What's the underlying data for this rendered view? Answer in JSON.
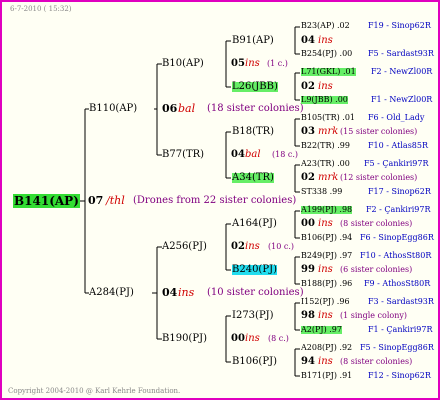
{
  "header": "6-7-2010 ( 15:32)",
  "footer": "Copyright 2004-2010 @ Karl Kehrle Foundation.",
  "root": {
    "label": "B141(AP)",
    "gen": "07",
    "mating": "/thl",
    "note": "(Drones from 22 sister colonies)"
  },
  "level1": [
    {
      "label": "B110(AP)",
      "gen": "06",
      "mating": "bal",
      "note": "(18 sister colonies)"
    },
    {
      "label": "A284(PJ)",
      "gen": "04",
      "mating": "ins",
      "note": "(10 sister colonies)"
    }
  ],
  "level2": [
    {
      "label": "B10(AP)",
      "gen": "05",
      "mating": "ins",
      "note": "(1 c.)"
    },
    {
      "label": "B77(TR)",
      "gen": "04",
      "mating": "bal",
      "note": "(18 c.)"
    },
    {
      "label": "A256(PJ)",
      "gen": "02",
      "mating": "ins",
      "note": "(10 c.)"
    },
    {
      "label": "B190(PJ)",
      "gen": "00",
      "mating": "ins",
      "note": "(8 c.)"
    }
  ],
  "level3": [
    "B91(AP)",
    "L26(JBB)",
    "B18(TR)",
    "A34(TR)",
    "A164(PJ)",
    "B240(PJ)",
    "I273(PJ)",
    "B106(PJ)"
  ],
  "level4": [
    {
      "top": "B23(AP) .02",
      "top_right": "F19 - Sinop62R",
      "mid_gen": "04",
      "mid_mating": "ins",
      "mid_note": "",
      "bottom": "B254(PJ) .00",
      "bottom_right": "F5 - Sardast93R"
    },
    {
      "top": "L71(GKL) .01",
      "top_right": "F2 - NewZl00R",
      "mid_gen": "02",
      "mid_mating": "ins",
      "mid_note": "",
      "bottom": "L9(JBB) .00",
      "bottom_right": "F1 - NewZl00R"
    },
    {
      "top": "B105(TR) .01",
      "top_right": "F6 - Old_Lady",
      "mid_gen": "03",
      "mid_mating": "mrk",
      "mid_note": "(15 sister colonies)",
      "bottom": "B22(TR) .99",
      "bottom_right": "F10 - Atlas85R"
    },
    {
      "top": "A23(TR) .00",
      "top_right": "F5 - Çankiri97R",
      "mid_gen": "02",
      "mid_mating": "mrk",
      "mid_note": "(12 sister colonies)",
      "bottom": "ST338 .99",
      "bottom_right": "F17 - Sinop62R"
    },
    {
      "top": "A199(PJ) .98",
      "top_right": "F2 - Çankiri97R",
      "mid_gen": "00",
      "mid_mating": "ins",
      "mid_note": "(8 sister colonies)",
      "bottom": "B106(PJ) .94",
      "bottom_right": "F6 - SinopEgg86R"
    },
    {
      "top": "B249(PJ) .97",
      "top_right": "F10 - AthosSt80R",
      "mid_gen": "99",
      "mid_mating": "ins",
      "mid_note": "(6 sister colonies)",
      "bottom": "B188(PJ) .96",
      "bottom_right": "F9 - AthosSt80R"
    },
    {
      "top": "I152(PJ) .96",
      "top_right": "F3 - Sardast93R",
      "mid_gen": "98",
      "mid_mating": "ins",
      "mid_note": "(1 single colony)",
      "bottom": "A2(PJ) .97",
      "bottom_right": "F1 - Çankiri97R"
    },
    {
      "top": "A208(PJ) .92",
      "top_right": "F5 - SinopEgg86R",
      "mid_gen": "94",
      "mid_mating": "ins",
      "mid_note": "(8 sister colonies)",
      "bottom": "B171(PJ) .91",
      "bottom_right": "F12 - Sinop62R"
    }
  ]
}
